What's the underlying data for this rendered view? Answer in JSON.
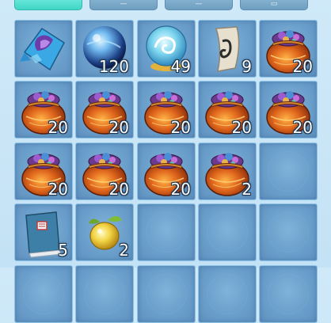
{
  "tabs": [
    {
      "name": "tab-1",
      "active": true,
      "glyph": ""
    },
    {
      "name": "tab-2",
      "active": false,
      "glyph": "—"
    },
    {
      "name": "tab-3",
      "active": false,
      "glyph": "—"
    },
    {
      "name": "tab-4",
      "active": false,
      "glyph": "▭"
    }
  ],
  "slots": [
    {
      "item": "purple-gem-pouch",
      "qty": ""
    },
    {
      "item": "blue-orb",
      "qty": "120"
    },
    {
      "item": "swirl-globe",
      "qty": "49"
    },
    {
      "item": "ancient-scroll",
      "qty": "9"
    },
    {
      "item": "treasure-bag",
      "qty": "20"
    },
    {
      "item": "treasure-bag",
      "qty": "20"
    },
    {
      "item": "treasure-bag",
      "qty": "20"
    },
    {
      "item": "treasure-bag",
      "qty": "20"
    },
    {
      "item": "treasure-bag",
      "qty": "20"
    },
    {
      "item": "treasure-bag",
      "qty": "20"
    },
    {
      "item": "treasure-bag",
      "qty": "20"
    },
    {
      "item": "treasure-bag",
      "qty": "20"
    },
    {
      "item": "treasure-bag",
      "qty": "20"
    },
    {
      "item": "treasure-bag",
      "qty": "2"
    },
    {
      "item": "",
      "qty": ""
    },
    {
      "item": "blue-book",
      "qty": "5"
    },
    {
      "item": "golden-fruit",
      "qty": "2"
    },
    {
      "item": "",
      "qty": ""
    },
    {
      "item": "",
      "qty": ""
    },
    {
      "item": "",
      "qty": ""
    },
    {
      "item": "",
      "qty": ""
    },
    {
      "item": "",
      "qty": ""
    },
    {
      "item": "",
      "qty": ""
    },
    {
      "item": "",
      "qty": ""
    },
    {
      "item": "",
      "qty": ""
    }
  ]
}
